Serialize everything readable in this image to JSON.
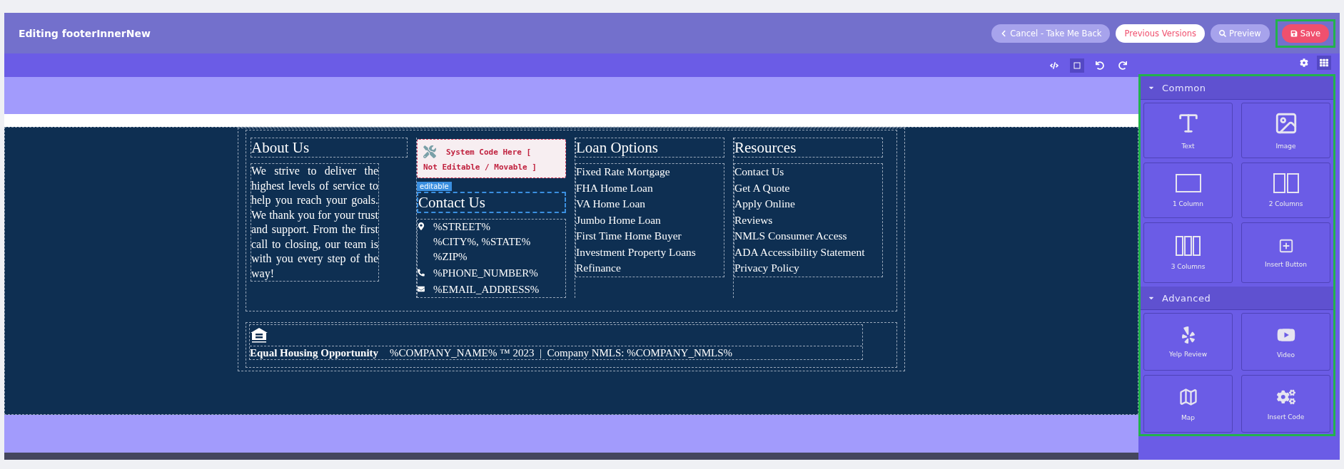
{
  "header": {
    "title": "Editing footerInnerNew",
    "buttons": [
      {
        "kind": "cancel",
        "label": "Cancel - Take Me Back"
      },
      {
        "kind": "history",
        "label": "Previous Versions"
      },
      {
        "kind": "preview",
        "label": "Preview"
      },
      {
        "kind": "save",
        "label": "Save"
      }
    ]
  },
  "footer": {
    "about": {
      "heading": "About Us",
      "text": "We strive to deliver the highest levels of service to help you reach your goals. We thank you for your trust and support. From the first call to closing, our team is with you every step of the way!"
    },
    "system_code": {
      "lines": [
        "System Code Here [",
        "Not Editable / Movable ]"
      ]
    },
    "badge": "editable",
    "contact": {
      "heading": "Contact Us",
      "items": [
        {
          "kind": "location",
          "lines": [
            "%STREET%",
            "%CITY%, %STATE% %ZIP%"
          ]
        },
        {
          "kind": "phone",
          "lines": [
            "%PHONE_NUMBER%"
          ]
        },
        {
          "kind": "email",
          "lines": [
            "%EMAIL_ADDRESS%"
          ]
        }
      ]
    },
    "link_columns": [
      {
        "heading": "Loan Options",
        "links": [
          "Fixed Rate Mortgage",
          "FHA Home Loan",
          "VA Home Loan",
          "Jumbo Home Loan",
          "First Time Home Buyer",
          "Investment Property Loans",
          "Refinance"
        ]
      },
      {
        "heading": "Resources",
        "links": [
          "Contact Us",
          "Get A Quote",
          "Apply Online",
          "Reviews",
          "NMLS Consumer Access",
          "ADA Accessibility Statement",
          "Privacy Policy"
        ]
      }
    ],
    "bottom": {
      "eho_label": "Equal Housing Opportunity",
      "copyright": "%COMPANY_NAME% ™ 2023  |  Company NMLS: %COMPANY_NMLS%"
    }
  },
  "sidebar": {
    "sections": [
      {
        "title": "Common",
        "expanded": true,
        "blocks": [
          {
            "kind": "text",
            "label": "Text"
          },
          {
            "kind": "image",
            "label": "Image"
          },
          {
            "kind": "one_column",
            "label": "1 Column"
          },
          {
            "kind": "two_columns",
            "label": "2 Columns"
          },
          {
            "kind": "three_columns",
            "label": "3 Columns"
          },
          {
            "kind": "button",
            "label": "Insert Button"
          }
        ]
      },
      {
        "title": "Advanced",
        "expanded": true,
        "blocks": [
          {
            "kind": "yelp",
            "label": "Yelp Review"
          },
          {
            "kind": "video",
            "label": "Video"
          },
          {
            "kind": "map",
            "label": "Map"
          },
          {
            "kind": "code",
            "label": "Insert Code"
          }
        ]
      }
    ]
  }
}
